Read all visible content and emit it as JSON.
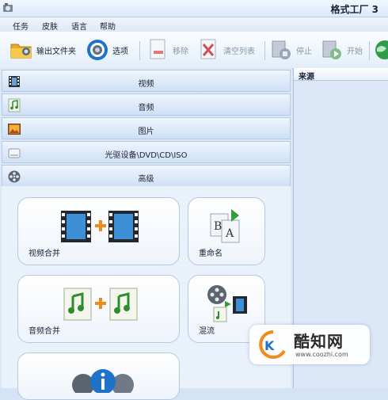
{
  "window": {
    "title": "格式工厂 3"
  },
  "menu": {
    "items": [
      "任务",
      "皮肤",
      "语言",
      "帮助"
    ]
  },
  "toolbar": {
    "output_folder": "输出文件夹",
    "options": "选项",
    "remove": "移除",
    "clear_list": "清空列表",
    "stop": "停止",
    "start": "开始"
  },
  "categories": [
    {
      "label": "视频",
      "icon": "film-icon"
    },
    {
      "label": "音频",
      "icon": "music-note-icon"
    },
    {
      "label": "图片",
      "icon": "image-icon"
    },
    {
      "label": "光驱设备\\DVD\\CD\\ISO",
      "icon": "disc-drive-icon"
    },
    {
      "label": "高级",
      "icon": "film-reel-icon"
    }
  ],
  "tiles": {
    "video_merge": "视频合并",
    "rename": "重命名",
    "audio_merge": "音频合并",
    "mux": "混流"
  },
  "file_list": {
    "column_source": "来源"
  },
  "watermark": {
    "name": "酷知网",
    "url": "www.coozhi.com"
  },
  "colors": {
    "accent": "#1e72c8",
    "panel": "#dbe8f8",
    "orange_plus": "#f08a1c"
  }
}
